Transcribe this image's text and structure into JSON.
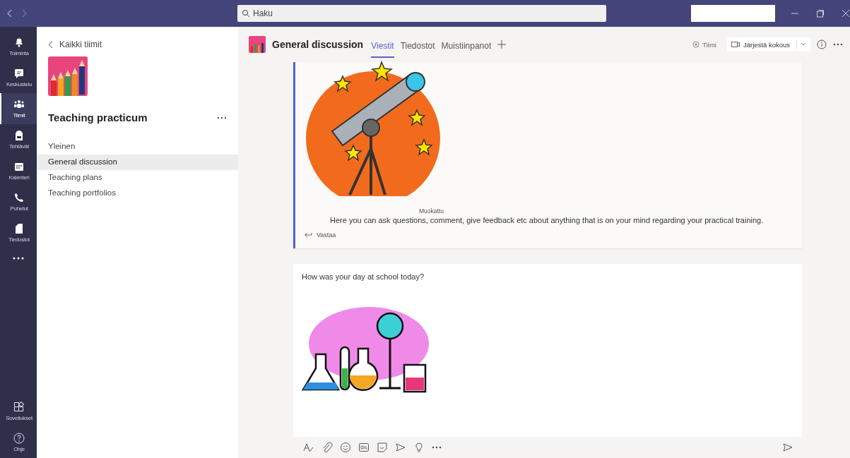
{
  "titlebar": {
    "search": {
      "placeholder": "Haku"
    }
  },
  "rail": {
    "items": [
      {
        "label": "Toiminta",
        "kind": "bell",
        "selected": false
      },
      {
        "label": "Keskustelu",
        "kind": "chat",
        "selected": false
      },
      {
        "label": "Tiimit",
        "kind": "teams",
        "selected": true
      },
      {
        "label": "Tehtävät",
        "kind": "bag",
        "selected": false
      },
      {
        "label": "Kalenteri",
        "kind": "calendar",
        "selected": false
      },
      {
        "label": "Puhelut",
        "kind": "phone",
        "selected": false
      },
      {
        "label": "Tiedostot",
        "kind": "file",
        "selected": false
      }
    ],
    "bottom": [
      {
        "label": "Sovellukset",
        "kind": "apps"
      },
      {
        "label": "Ohje",
        "kind": "help"
      }
    ]
  },
  "team": {
    "back": "Kaikki tiimit",
    "name": "Teaching practicum",
    "channels": [
      {
        "label": "Yleinen",
        "selected": false
      },
      {
        "label": "General discussion",
        "selected": true
      },
      {
        "label": "Teaching plans",
        "selected": false
      },
      {
        "label": "Teaching portfolios",
        "selected": false
      }
    ]
  },
  "header": {
    "title": "General discussion",
    "tabs": [
      {
        "label": "Viestit",
        "selected": true
      },
      {
        "label": "Tiedostot",
        "selected": false
      },
      {
        "label": "Muistiinpanot",
        "selected": false
      }
    ],
    "team_button": "Tiimi",
    "meet_button": "Järjestä kokous"
  },
  "post": {
    "edited": "Muokattu",
    "text": "Here you can ask questions, comment, give feedback etc about anything that is on your mind regarding your practical training.",
    "reply": "Vastaa"
  },
  "compose": {
    "text": "How was your day at school today?"
  }
}
